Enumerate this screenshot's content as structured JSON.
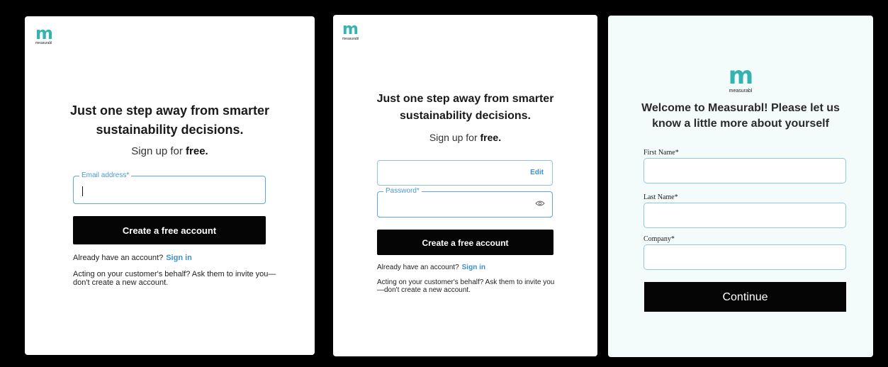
{
  "brand": {
    "logo_mark": "m",
    "logo_word": "measurabl",
    "accent_color": "#35b3b1"
  },
  "panel1": {
    "heading_line1": "Just one step away from smarter",
    "heading_line2": "sustainability decisions.",
    "sub_prefix": "Sign up for ",
    "sub_bold": "free.",
    "email_label": "Email address*",
    "email_value": "",
    "button_label": "Create a free account",
    "already_text": "Already have an account?",
    "sign_in_label": "Sign in",
    "behalf_text": "Acting on your customer's behalf? Ask them to invite you—don't create a new account."
  },
  "panel2": {
    "heading_line1": "Just one step away from smarter",
    "heading_line2": "sustainability decisions.",
    "sub_prefix": "Sign up for ",
    "sub_bold": "free.",
    "email_value": "",
    "edit_label": "Edit",
    "password_label": "Password*",
    "password_value": "",
    "password_toggle_icon": "eye-icon",
    "button_label": "Create a free account",
    "already_text": "Already have an account?",
    "sign_in_label": "Sign in",
    "behalf_text": "Acting on your customer's behalf? Ask them to invite you—don't create a new account."
  },
  "panel3": {
    "heading_line1": "Welcome to Measurabl! Please let us",
    "heading_line2": "know a little more about yourself",
    "first_name_label": "First Name*",
    "first_name_value": "",
    "last_name_label": "Last Name*",
    "last_name_value": "",
    "company_label": "Company*",
    "company_value": "",
    "continue_label": "Continue"
  },
  "colors": {
    "button_bg": "#050505",
    "link": "#3c8fcf",
    "field_border": "#5fa8d8",
    "panel3_bg": "#f4fbfb"
  }
}
